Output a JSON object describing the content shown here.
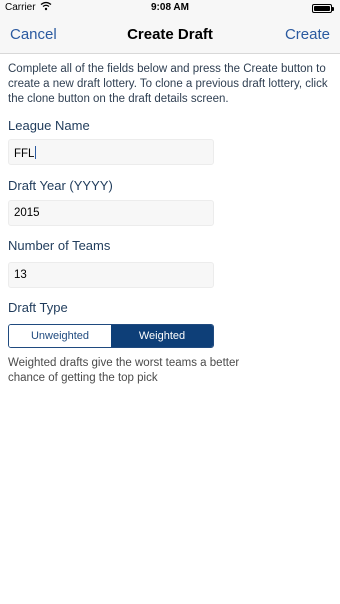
{
  "status_bar": {
    "carrier": "Carrier",
    "time": "9:08 AM"
  },
  "nav": {
    "left_label": "Cancel",
    "title": "Create Draft",
    "right_label": "Create"
  },
  "intro_text": "Complete all of the fields below and press the Create button to create a new draft lottery. To clone a previous draft lottery, click the clone button on the draft details screen.",
  "fields": {
    "league_name": {
      "label": "League Name",
      "value": "FFL"
    },
    "draft_year": {
      "label": "Draft Year (YYYY)",
      "value": "2015"
    },
    "number_of_teams": {
      "label": "Number of Teams",
      "value": "13"
    }
  },
  "draft_type": {
    "label": "Draft Type",
    "options": [
      "Unweighted",
      "Weighted"
    ],
    "selected": "Weighted",
    "description": "Weighted drafts give the worst teams a better chance of getting the top pick"
  },
  "colors": {
    "accent": "#2b5aa0",
    "segment_selected": "#0e3f78"
  }
}
